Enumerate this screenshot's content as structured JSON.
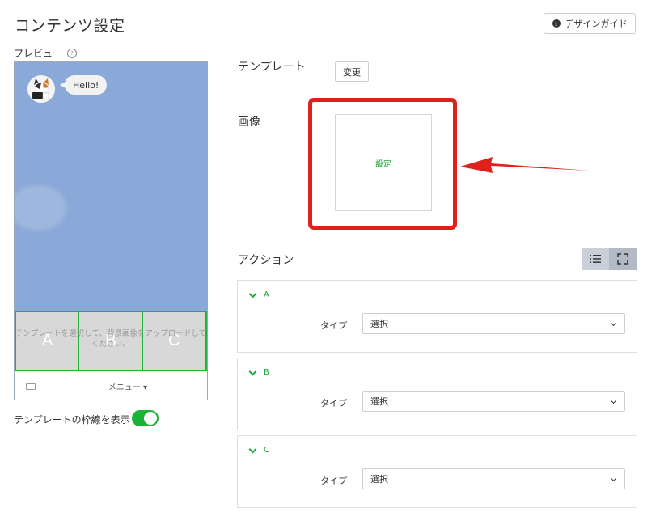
{
  "header": {
    "title": "コンテンツ設定",
    "guide_button": "デザインガイド",
    "guide_icon": "info-icon"
  },
  "preview": {
    "label": "プレビュー",
    "help_icon": "question-icon",
    "bubble_text": "Hello!",
    "cells": [
      "A",
      "B",
      "C"
    ],
    "hint": "テンプレートを選択して、背景画像をアップロードしてください。",
    "menu_label": "メニュー ▾",
    "frame_toggle_label": "テンプレートの枠線を表示",
    "frame_toggle_on": true,
    "colors": {
      "chat_bg": "#8aa8d8",
      "accent": "#19b437"
    }
  },
  "settings": {
    "template_label": "テンプレート",
    "change_button": "変更",
    "image_label": "画像",
    "image_set_label": "設定",
    "highlight_color": "#e0201a"
  },
  "actions": {
    "label": "アクション",
    "view_icons": [
      "list-icon",
      "expand-icon"
    ],
    "cards": [
      {
        "name": "A",
        "type_label": "タイプ",
        "select_value": "選択"
      },
      {
        "name": "B",
        "type_label": "タイプ",
        "select_value": "選択"
      },
      {
        "name": "C",
        "type_label": "タイプ",
        "select_value": "選択"
      }
    ]
  }
}
